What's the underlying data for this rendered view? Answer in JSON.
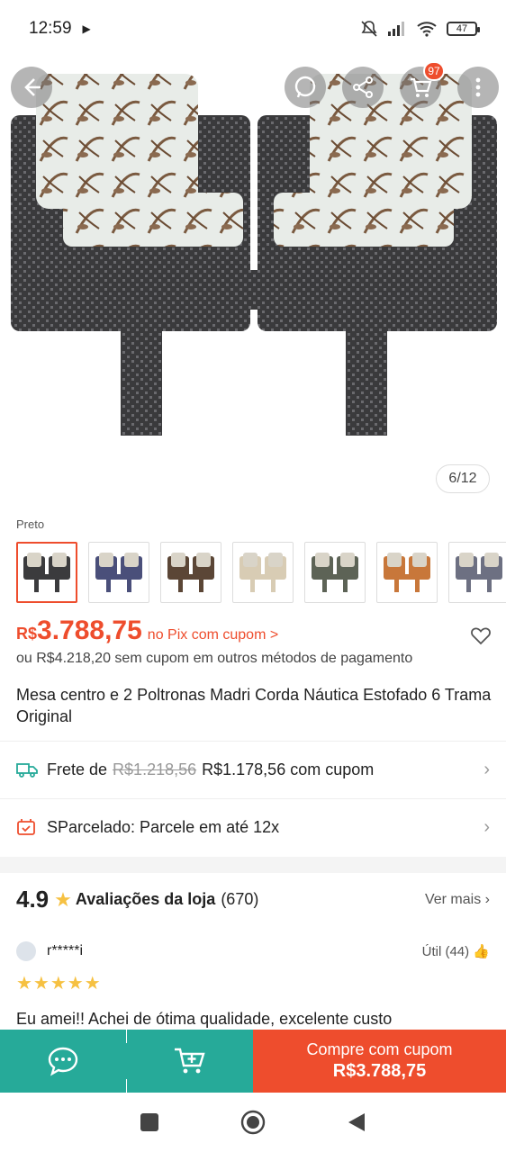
{
  "status_bar": {
    "time": "12:59",
    "battery": "47"
  },
  "top_bar": {
    "cart_badge": "97"
  },
  "gallery": {
    "counter": "6/12"
  },
  "variants": {
    "label": "Preto",
    "options": [
      {
        "name": "preto",
        "color": "#3b3b3d",
        "selected": true
      },
      {
        "name": "azul",
        "color": "#4a4f7a",
        "selected": false
      },
      {
        "name": "marrom",
        "color": "#5b4636",
        "selected": false
      },
      {
        "name": "bege",
        "color": "#d8ccb4",
        "selected": false
      },
      {
        "name": "verde",
        "color": "#5d6356",
        "selected": false
      },
      {
        "name": "laranja",
        "color": "#c8773a",
        "selected": false
      },
      {
        "name": "cinza",
        "color": "#6d7082",
        "selected": false
      }
    ]
  },
  "price": {
    "currency": "R$",
    "value": "3.788,75",
    "pix_label": "no Pix com cupom >",
    "alt": "ou R$4.218,20 sem cupom em outros métodos de pagamento"
  },
  "product": {
    "title": "Mesa centro e 2 Poltronas Madri Corda Náutica Estofado 6 Trama Original"
  },
  "shipping": {
    "label": "Frete de",
    "old_price": "R$1.218,56",
    "new_price": "R$1.178,56 com cupom"
  },
  "installments": {
    "label": "SParcelado: Parcele em até 12x"
  },
  "reviews": {
    "rating": "4.9",
    "label": "Avaliações da loja",
    "count": "(670)",
    "see_more": "Ver mais",
    "reviewer": "r*****i",
    "helpful": "Útil (44)",
    "stars": "★★★★★",
    "text": "Eu amei!! Achei de ótima qualidade,  excelente custo"
  },
  "action_bar": {
    "buy_line1": "Compre com cupom",
    "buy_line2": "R$3.788,75"
  },
  "colors": {
    "accent": "#ee4d2d",
    "teal": "#26aa99",
    "star": "#f6c142"
  }
}
